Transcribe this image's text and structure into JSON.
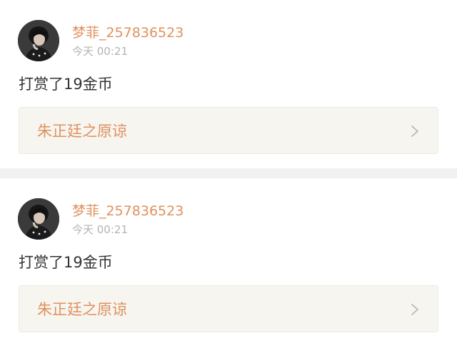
{
  "posts": [
    {
      "username": "梦菲_257836523",
      "timestamp": "今天 00:21",
      "message": "打赏了19金币",
      "link_title": "朱正廷之原谅",
      "link_icon": "chevron-right-icon",
      "avatar": "user-avatar"
    },
    {
      "username": "梦菲_257836523",
      "timestamp": "今天 00:21",
      "message": "打赏了19金币",
      "link_title": "朱正廷之原谅",
      "link_icon": "chevron-right-icon",
      "avatar": "user-avatar"
    }
  ],
  "colors": {
    "username": "#e0915f",
    "link_title": "#e0915f",
    "timestamp": "#b3b3b3",
    "message": "#333333",
    "link_bg": "#f6f5ef",
    "page_bg": "#f1f1f1"
  }
}
